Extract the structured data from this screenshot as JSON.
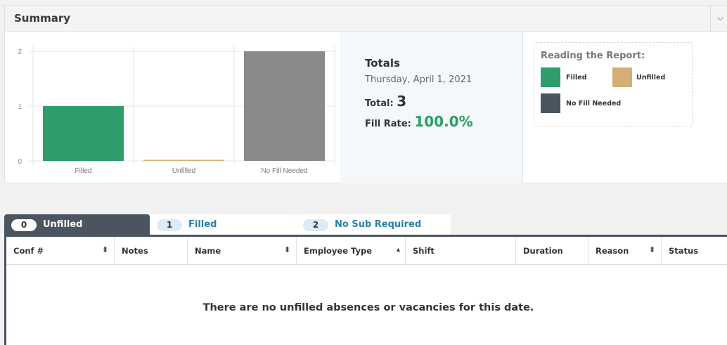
{
  "summary": {
    "title": "Summary",
    "collapse_icon": "chevron-down-icon"
  },
  "chart_data": {
    "type": "bar",
    "categories": [
      "Filled",
      "Unfilled",
      "No Fill Needed"
    ],
    "values": [
      1,
      0,
      2
    ],
    "colors": [
      "#2e9e6a",
      "#d4ae76",
      "#8a8a8a"
    ],
    "yticks": [
      "0",
      "1",
      "2"
    ],
    "ylim": [
      0,
      2
    ],
    "grid": true
  },
  "totals": {
    "title": "Totals",
    "date": "Thursday, April 1, 2021",
    "total_label": "Total:",
    "total_value": "3",
    "fill_rate_label": "Fill Rate:",
    "fill_rate_value": "100.0%"
  },
  "legend": {
    "title": "Reading the Report:",
    "items": [
      {
        "label": "Filled",
        "color": "#2e9e6a"
      },
      {
        "label": "Unfilled",
        "color": "#d4ae76"
      },
      {
        "label": "No Fill Needed",
        "color": "#4a5560"
      }
    ]
  },
  "tabs": [
    {
      "count": "0",
      "label": "Unfilled",
      "active": true
    },
    {
      "count": "1",
      "label": "Filled",
      "active": false
    },
    {
      "count": "2",
      "label": "No Sub Required",
      "active": false
    }
  ],
  "table": {
    "columns": [
      {
        "label": "Conf #",
        "sort": "both"
      },
      {
        "label": "Notes",
        "sort": "none"
      },
      {
        "label": "Name",
        "sort": "both"
      },
      {
        "label": "Employee Type",
        "sort": "asc"
      },
      {
        "label": "Shift",
        "sort": "none"
      },
      {
        "label": "Duration",
        "sort": "none"
      },
      {
        "label": "Reason",
        "sort": "both"
      },
      {
        "label": "Status",
        "sort": "none"
      }
    ],
    "empty_message": "There are no unfilled absences or vacancies for this date."
  }
}
